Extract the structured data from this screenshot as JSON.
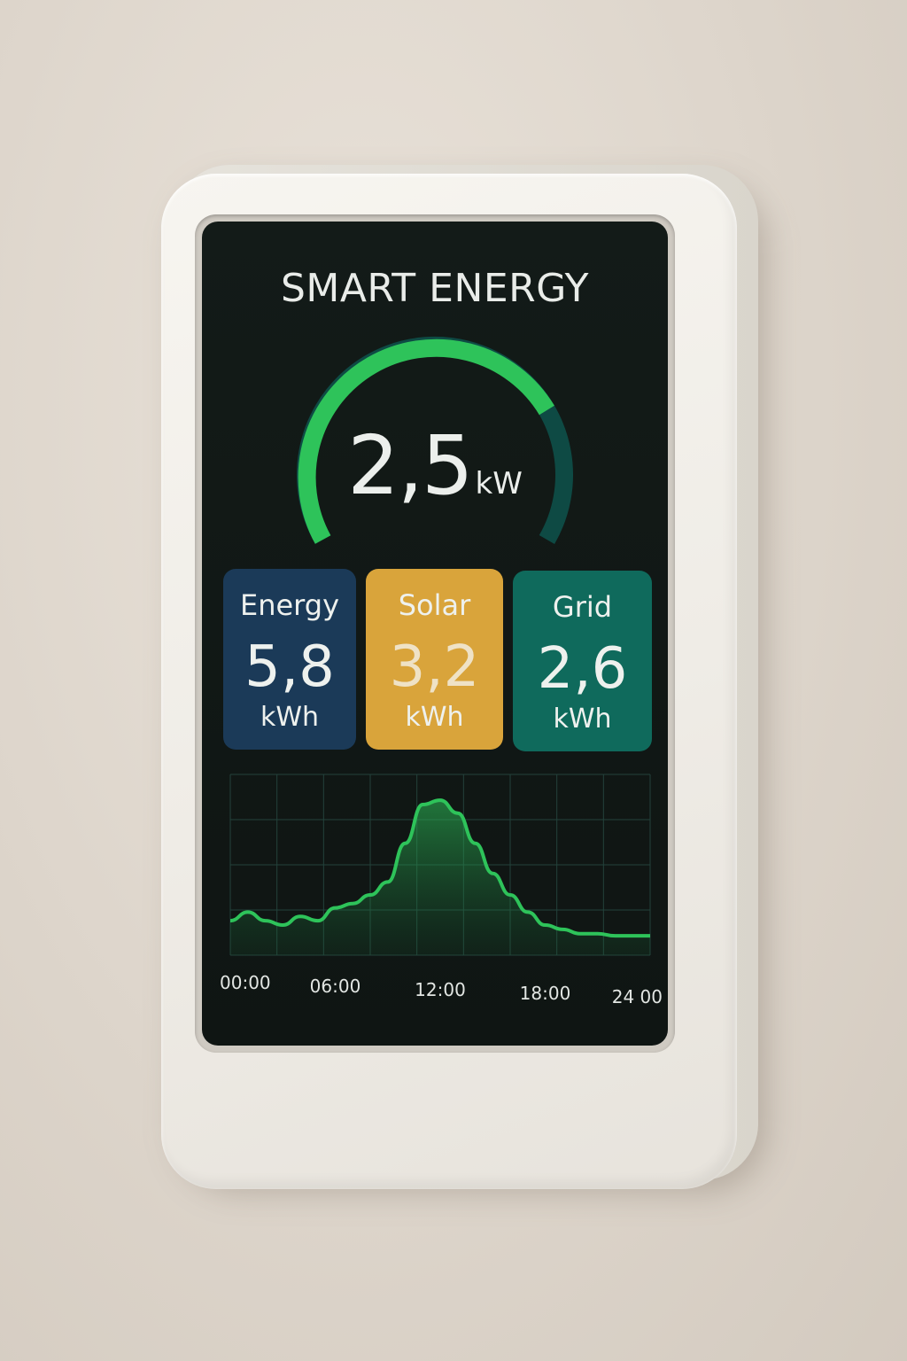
{
  "screen": {
    "title": "SMART ENERGY",
    "power": {
      "value": "2,5",
      "unit": "kW",
      "fraction": 0.75
    },
    "colors": {
      "accent": "#2ec35a",
      "gauge_rest": "#0e4a44",
      "energy": "#1b3a58",
      "solar": "#d9a43b",
      "grid": "#0f6a5c"
    }
  },
  "cards": [
    {
      "label": "Energy",
      "value": "5,8",
      "unit": "kWh"
    },
    {
      "label": "Solar",
      "value": "3,2",
      "unit": "kWh"
    },
    {
      "label": "Grid",
      "value": "2,6",
      "unit": "kWh"
    }
  ],
  "chart_data": {
    "type": "area",
    "title": "",
    "xlabel": "",
    "ylabel": "",
    "x_ticks": [
      "00:00",
      "06:00",
      "12:00",
      "18:00",
      "24 00"
    ],
    "x": [
      0,
      1,
      2,
      3,
      4,
      5,
      6,
      7,
      8,
      9,
      10,
      11,
      12,
      13,
      14,
      15,
      16,
      17,
      18,
      19,
      20,
      21,
      22,
      23,
      24
    ],
    "y": [
      0.8,
      1.0,
      0.8,
      0.7,
      0.9,
      0.8,
      1.1,
      1.2,
      1.4,
      1.7,
      2.6,
      3.5,
      3.6,
      3.3,
      2.6,
      1.9,
      1.4,
      1.0,
      0.7,
      0.6,
      0.5,
      0.5,
      0.45,
      0.45,
      0.45
    ],
    "ylim": [
      0,
      4.2
    ],
    "grid": true,
    "series": [
      {
        "values_ref": "y"
      }
    ]
  }
}
